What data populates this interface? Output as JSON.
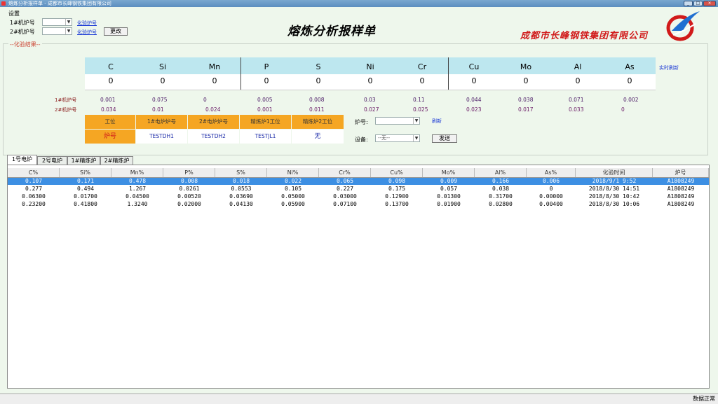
{
  "window": {
    "title": "熔炼分析报样单 - 成都市长峰钢铁集团有限公司"
  },
  "top": {
    "panel_title": "设置",
    "row1_label": "1#机炉号",
    "row2_label": "2#机炉号",
    "row1_link": "化验炉号",
    "row2_link": "化验炉号",
    "refresh_button": "更改"
  },
  "main_title": "熔炼分析报样单",
  "company": "成都市长峰钢铁集团有限公司",
  "group_label": "--化验结果--",
  "elements": [
    "C",
    "Si",
    "Mn",
    "P",
    "S",
    "Ni",
    "Cr",
    "Cu",
    "Mo",
    "Al",
    "As"
  ],
  "element_values": [
    "0",
    "0",
    "0",
    "0",
    "0",
    "0",
    "0",
    "0",
    "0",
    "0",
    "0"
  ],
  "realtime_link": "实时刷新",
  "row1_label": "1#机炉号",
  "row2_label": "2#机炉号",
  "row1_values": [
    "0.001",
    "0.075",
    "0",
    "0.005",
    "0.008",
    "0.03",
    "0.11",
    "0.044",
    "0.038",
    "0.071",
    "0.002"
  ],
  "row2_values": [
    "0.034",
    "0.01",
    "0.024",
    "0.001",
    "0.011",
    "0.027",
    "0.025",
    "0.023",
    "0.017",
    "0.033",
    "0"
  ],
  "furnace_table": {
    "headers": [
      "工位",
      "1#电炉炉号",
      "2#电炉炉号",
      "精炼炉1工位",
      "精炼炉2工位"
    ],
    "values": [
      "炉号",
      "TESTDH1",
      "TESTDH2",
      "TESTJL1",
      "无"
    ]
  },
  "furnace_select_label": "炉号:",
  "furnace_select_value": "",
  "furnace_link": "刷新",
  "device_label": "设备:",
  "device_select_value": "--无--",
  "send_button": "发送",
  "tabs": [
    "1号电炉",
    "2号电炉",
    "1#精炼炉",
    "2#精炼炉"
  ],
  "grid": {
    "columns": [
      "C%",
      "Si%",
      "Mn%",
      "P%",
      "S%",
      "Ni%",
      "Cr%",
      "Cu%",
      "Mo%",
      "Al%",
      "As%",
      "化验时间",
      "炉号"
    ],
    "rows": [
      [
        "0.107",
        "0.171",
        "0.478",
        "0.008",
        "0.018",
        "0.022",
        "0.065",
        "0.098",
        "0.009",
        "0.166",
        "0.006",
        "2018/9/1 9:52",
        "A1808249"
      ],
      [
        "0.277",
        "0.494",
        "1.267",
        "0.0261",
        "0.0553",
        "0.105",
        "0.227",
        "0.175",
        "0.057",
        "0.038",
        "0",
        "2018/8/30 14:51",
        "A1808249"
      ],
      [
        "0.06300",
        "0.01700",
        "0.04500",
        "0.00520",
        "0.03690",
        "0.05000",
        "0.03000",
        "0.12900",
        "0.01300",
        "0.31700",
        "0.00000",
        "2018/8/30 10:42",
        "A1808249"
      ],
      [
        "0.23200",
        "0.41800",
        "1.3240",
        "0.02000",
        "0.04130",
        "0.05900",
        "0.07100",
        "0.13700",
        "0.01900",
        "0.02800",
        "0.00400",
        "2018/8/30 10:06",
        "A1808249"
      ]
    ],
    "selected_row": 0
  },
  "status": "数据正常"
}
